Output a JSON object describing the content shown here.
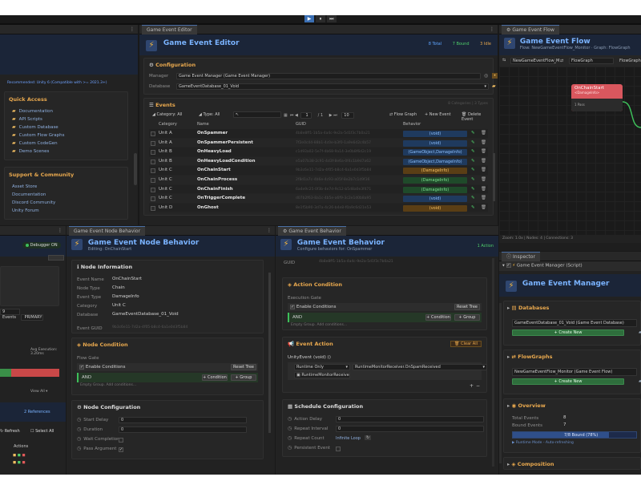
{
  "colors": {
    "accent": "#7ab3ff",
    "header": "#1b2538",
    "orange": "#e8a84e",
    "green": "#3dbf5a",
    "red": "#c94848",
    "pink_node": "#d9575e"
  },
  "playbar": {
    "play": "▶",
    "pause": "⏸",
    "step": "⏭"
  },
  "left": {
    "recommended": "Recommended: Unity 6 (Compatible with >= 2021.3+)",
    "quick_access_title": "Quick Access",
    "quick_access": [
      "Documentation",
      "API Scripts",
      "Custom Database",
      "Custom Flow Graphs",
      "Custom CodeGen",
      "Demo Scenes"
    ],
    "support_title": "Support & Community",
    "support": [
      "Asset Store",
      "Documentation",
      "Discord Community",
      "Unity Forum"
    ]
  },
  "editor": {
    "tab": "Game Event Editor",
    "title": "Game Event Editor",
    "stats": {
      "total": "8 Total",
      "bound": "7 Bound",
      "idle": "3 Idle"
    },
    "config_title": "Configuration",
    "manager_label": "Manager",
    "manager_value": "Game Event Manager (Game Event Manager)",
    "database_label": "Database",
    "database_value": "GameEventDatabase_01_Void",
    "events_title": "Events",
    "events_count": "8 Categories | 3 Types",
    "toolbar": {
      "category": "Category: All",
      "type": "Type: All",
      "page": "1",
      "of": "/ 1",
      "per_page": "10",
      "flow_graph": "Flow Graph",
      "new_event": "New Event",
      "delete_event": "Delete Event"
    },
    "columns": [
      "Category",
      "Name",
      "GUID",
      "Behavior"
    ],
    "rows": [
      {
        "cat": "Unit A",
        "name": "OnSpammer",
        "guid": "4b8e8ff1-1b5a-4a4c-9e2a-5d1f3c7b0a21",
        "beh": "(void)",
        "t": "void"
      },
      {
        "cat": "Unit A",
        "name": "OnSpammerPersistent",
        "guid": "7f2e0c44-88b1-4c0e-b3f0-1a9e6d2c4b57",
        "beh": "(void)",
        "t": "void"
      },
      {
        "cat": "Unit B",
        "name": "OnHeavyLoad",
        "guid": "c1d93a02-5e7f-4b68-9a14-3e0b8f6d2c19",
        "beh": "(GameObject,DamageInfo)",
        "t": "go"
      },
      {
        "cat": "Unit B",
        "name": "OnHeavyLoadCondition",
        "guid": "e5a07b38-2c91-4d3f-8e6a-0f4c1b9d7a62",
        "beh": "(GameObject,DamageInfo)",
        "t": "go"
      },
      {
        "cat": "Unit C",
        "name": "OnChainStart",
        "guid": "9b3c6e11-7d2a-4f05-b8c4-6a1e0d3f5b84",
        "beh": "(DamageInfo)",
        "t": "dmg"
      },
      {
        "cat": "Unit C",
        "name": "OnChainProcess",
        "guid": "2f8d1a7c-4b6e-4c93-a05f-8e2b7c1d9f36",
        "beh": "(DamageInfo)",
        "t": "dmg2"
      },
      {
        "cat": "Unit C",
        "name": "OnChainFinish",
        "guid": "6a4e9c25-0f3b-4e7d-9c12-b5d8a0e3f471",
        "beh": "(DamageInfo)",
        "t": "dmg2"
      },
      {
        "cat": "Unit C",
        "name": "OnTriggerComplete",
        "guid": "d07b2f63-8a1c-4b5e-a6f9-3c2e1d0b8a95",
        "beh": "(void)",
        "t": "void"
      },
      {
        "cat": "Unit D",
        "name": "OnGhost",
        "guid": "8e1f5b90-3d7a-4c26-b4e8-f0a9c6d21e53",
        "beh": "(void)",
        "t": "voidorange"
      }
    ]
  },
  "flow": {
    "tab": "Game Event Flow",
    "title": "Game Event Flow",
    "subtitle": "Flow: NewGameEventFlow_Monitor · Graph: FlowGraph",
    "select1": "NewGameEventFlow_M",
    "select2": "FlowGraph",
    "graph_label": "FlowGraph",
    "node_title": "OnChainStart",
    "node_sub": "<DamageInfo>",
    "node_port": "1 Pass",
    "status": "Zoom: 1.0x | Nodes: 4 | Connections: 3"
  },
  "monitor": {
    "debugger": "Debugger ON",
    "avg": "Avg Execution: 3.20ms",
    "events_tab": "9 Events",
    "primary_tab": "PRIMARY",
    "view_all": "View All",
    "refs": "2 References",
    "refresh": "Refresh",
    "select_all": "Select All",
    "actions": "Actions"
  },
  "node_behavior": {
    "tab": "Game Event Node Behavior",
    "title": "Game Event Node Behavior",
    "subtitle": "Editing: OnChainStart",
    "info_title": "Node Information",
    "info": [
      {
        "k": "Event Name",
        "v": "OnChainStart"
      },
      {
        "k": "Node Type",
        "v": "Chain"
      },
      {
        "k": "Event Type",
        "v": "DamageInfo"
      },
      {
        "k": "Category",
        "v": "Unit C"
      },
      {
        "k": "Database",
        "v": "GameEventDatabase_01_Void"
      }
    ],
    "guid_label": "Event GUID",
    "guid": "9b3c6e11-7d2a-4f05-b8c4-6a1e0d3f5b84",
    "cond_title": "Node Condition",
    "flow_gate": "Flow Gate",
    "enable_conditions": "Enable Conditions",
    "reset_tree": "Reset Tree",
    "and": "AND",
    "add_condition": "+ Condition",
    "add_group": "+ Group",
    "empty_group": "Empty Group. Add conditions...",
    "config_title": "Node Configuration",
    "cfg": [
      {
        "k": "Start Delay",
        "v": "0"
      },
      {
        "k": "Duration",
        "v": "0"
      },
      {
        "k": "Wait Completion",
        "v": ""
      },
      {
        "k": "Pass Argument",
        "v": "✓"
      }
    ]
  },
  "behavior": {
    "tab": "Game Event Behavior",
    "title": "Game Event Behavior",
    "subtitle": "Configure behaviors for: OnSpammer",
    "action_badge": "1 Action",
    "guid_label": "GUID",
    "guid": "4b8e8ff1-1b5a-4a4c-9e2a-5d1f3c7b0a21",
    "action_cond_title": "Action Condition",
    "exec_gate": "Execution Gate",
    "enable_conditions": "Enable Conditions",
    "reset_tree": "Reset Tree",
    "and": "AND",
    "add_condition": "+ Condition",
    "add_group": "+ Group",
    "empty_group": "Empty Group. Add conditions...",
    "event_action_title": "Event Action",
    "clear_all": "Clear All",
    "unity_event": "UnityEvent (void) ()",
    "runtime_only": "Runtime Only",
    "method": "RuntimeMonitorReceiver.OnSpamReceived",
    "target": "RuntimeMonitorReceive",
    "schedule_title": "Schedule Configuration",
    "sched": [
      {
        "k": "Action Delay",
        "v": "0"
      },
      {
        "k": "Repeat Interval",
        "v": "0"
      },
      {
        "k": "Repeat Count",
        "v": "Infinite Loop"
      },
      {
        "k": "Persistent Event",
        "v": ""
      }
    ]
  },
  "inspector": {
    "tab": "Inspector",
    "component": "Game Event Manager (Script)",
    "title": "Game Event Manager",
    "db_title": "Databases",
    "db_value": "GameEventDatabase_01_Void (Game Event Database)",
    "create_new": "Create New",
    "fg_title": "FlowGraphs",
    "fg_value": "NewGameEventFlow_Monitor (Game Event Flow)",
    "overview_title": "Overview",
    "total_label": "Total Events",
    "total_value": "8",
    "bound_label": "Bound Events",
    "bound_value": "7",
    "bound_bar": "7/8 Bound (78%)",
    "bound_fraction": 0.78,
    "runtime": "Runtime Mode - Auto-refreshing",
    "composition_title": "Composition"
  }
}
